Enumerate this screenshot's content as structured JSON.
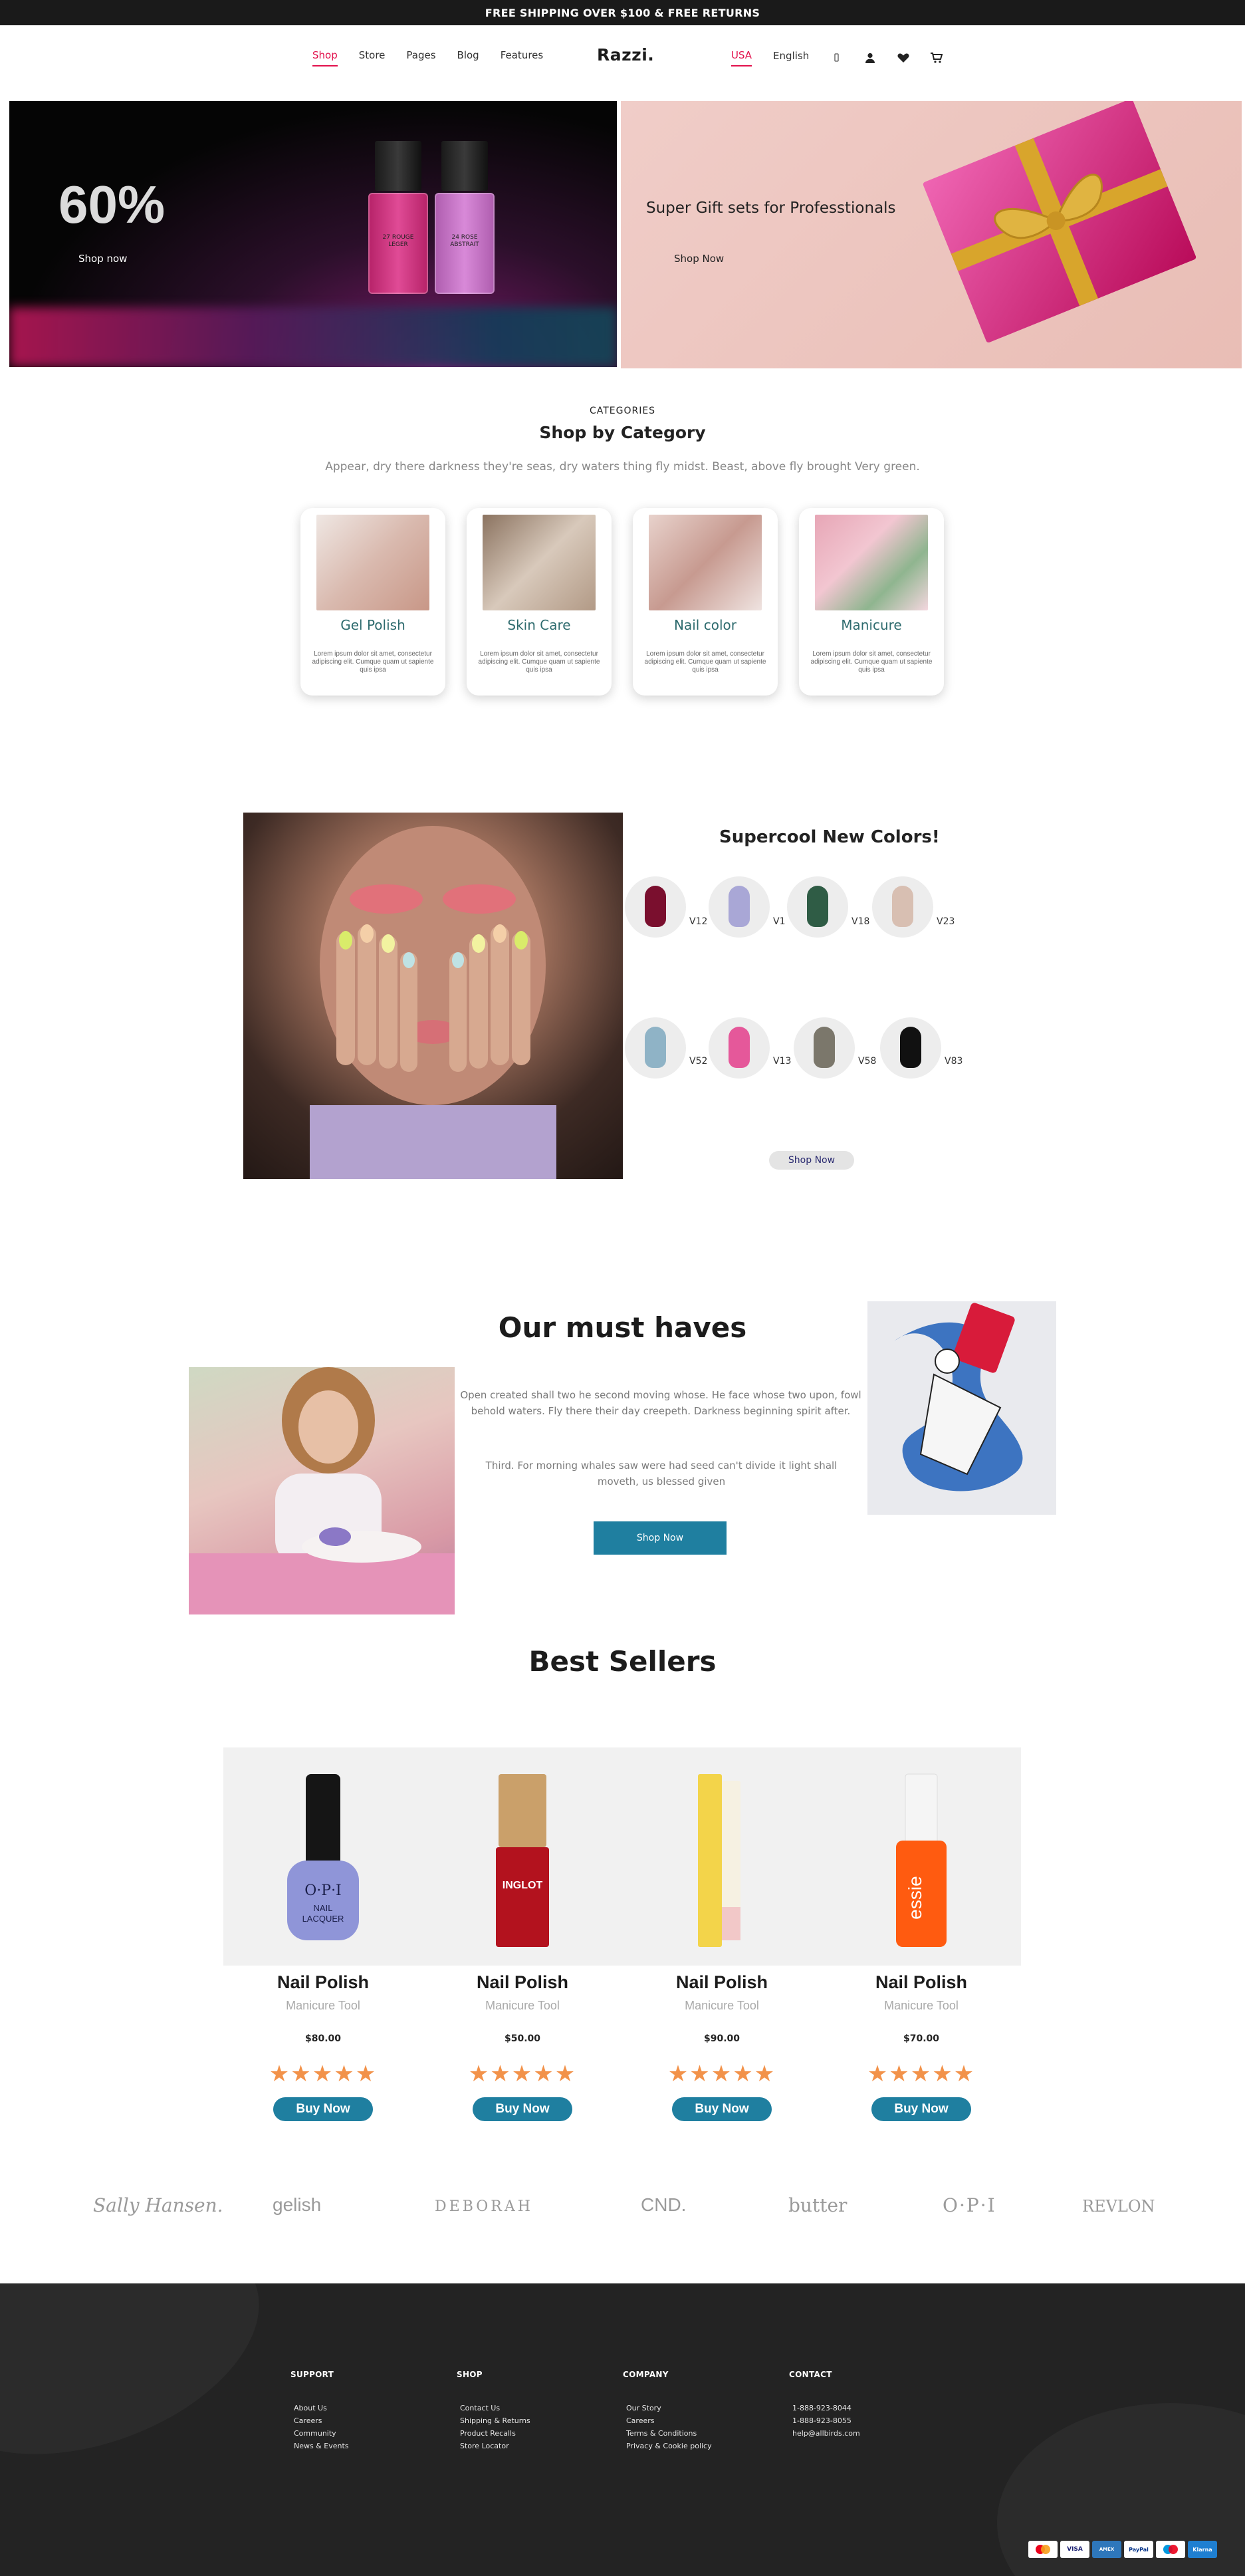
{
  "topbar": {
    "text": "FREE SHIPPING OVER $100 & FREE RETURNS"
  },
  "header": {
    "nav": [
      "Shop",
      "Store",
      "Pages",
      "Blog",
      "Features"
    ],
    "logo": "Razzi.",
    "region": "USA",
    "language": "English",
    "icons": [
      "search-icon",
      "user-icon",
      "heart-icon",
      "cart-icon"
    ],
    "accent_color": "#e2104b"
  },
  "hero": {
    "left": {
      "percent": "60%",
      "cta": "Shop now",
      "bottle_labels": [
        "27 ROUGE LEGER",
        "24 ROSE ABSTRAIT"
      ]
    },
    "right": {
      "title": "Super Gift sets for Professtionals",
      "cta": "Shop Now"
    }
  },
  "categories": {
    "eyebrow": "CATEGORIES",
    "title": "Shop by Category",
    "description": "Appear, dry there darkness they're seas, dry waters thing fly midst. Beast, above fly brought Very green.",
    "items": [
      {
        "name": "Gel Polish",
        "desc": "Lorem ipsum dolor sit amet, consectetur adipiscing elit. Cumque quam ut sapiente quis ipsa"
      },
      {
        "name": "Skin Care",
        "desc": "Lorem ipsum dolor sit amet, consectetur adipiscing elit. Cumque quam ut sapiente quis ipsa"
      },
      {
        "name": "Nail color",
        "desc": "Lorem ipsum dolor sit amet, consectetur adipiscing elit. Cumque quam ut sapiente quis ipsa"
      },
      {
        "name": "Manicure",
        "desc": "Lorem ipsum dolor sit amet, consectetur adipiscing elit. Cumque quam ut sapiente quis ipsa"
      }
    ]
  },
  "colors": {
    "title": "Supercool New Colors!",
    "swatches": [
      {
        "code": "V12",
        "color": "#7a0f2e"
      },
      {
        "code": "V1",
        "color": "#a9a7d6"
      },
      {
        "code": "V18",
        "color": "#2f5c45"
      },
      {
        "code": "V23",
        "color": "#d8bfb2"
      },
      {
        "code": "V52",
        "color": "#8fb3c6"
      },
      {
        "code": "V13",
        "color": "#e5589a"
      },
      {
        "code": "V58",
        "color": "#7b776b"
      },
      {
        "code": "V83",
        "color": "#111111"
      }
    ],
    "cta": "Shop Now"
  },
  "must_haves": {
    "title": "Our must haves",
    "p1": "Open created shall two he second moving whose. He face whose two upon, fowl behold waters. Fly there their day creepeth. Darkness beginning spirit after.",
    "p2": "Third. For morning whales saw were had seed can't divide it light shall moveth, us blessed given",
    "cta": "Shop Now"
  },
  "best_sellers": {
    "title": "Best Sellers",
    "products": [
      {
        "name": "Nail Polish",
        "sub": "Manicure Tool",
        "price": "$80.00",
        "stars": 5,
        "cta": "Buy Now",
        "brand_label": "O·P·I",
        "color": "#8f95d8"
      },
      {
        "name": "Nail Polish",
        "sub": "Manicure Tool",
        "price": "$50.00",
        "stars": 5,
        "cta": "Buy Now",
        "brand_label": "INGLOT",
        "color": "#b3121e"
      },
      {
        "name": "Nail Polish",
        "sub": "Manicure Tool",
        "price": "$90.00",
        "stars": 5,
        "cta": "Buy Now",
        "brand_label": "",
        "color": "#f3d44a"
      },
      {
        "name": "Nail Polish",
        "sub": "Manicure Tool",
        "price": "$70.00",
        "stars": 5,
        "cta": "Buy Now",
        "brand_label": "essie",
        "color": "#ff5b10"
      }
    ],
    "star_glyph": "★★★★★",
    "button_color": "#1f7fa0"
  },
  "brands": [
    "Sally Hansen.",
    "gelish",
    "DEBORAH",
    "CND.",
    "butter",
    "O·P·I",
    "REVLON"
  ],
  "footer": {
    "columns": [
      {
        "heading": "SUPPORT",
        "items": [
          "About Us",
          "Careers",
          "Community",
          "News & Events"
        ]
      },
      {
        "heading": "SHOP",
        "items": [
          "Contact Us",
          "Shipping & Returns",
          "Product Recalls",
          "Store Locator"
        ]
      },
      {
        "heading": "COMPANY",
        "items": [
          "Our Story",
          "Careers",
          "Terms & Conditions",
          "Privacy & Cookie policy"
        ]
      },
      {
        "heading": "CONTACT",
        "items": [
          "1-888-923-8044",
          "1-888-923-8055",
          "help@allbirds.com"
        ]
      }
    ],
    "payments": [
      "mastercard",
      "VISA",
      "AMEX",
      "PayPal",
      "maestro",
      "Klarna"
    ]
  }
}
